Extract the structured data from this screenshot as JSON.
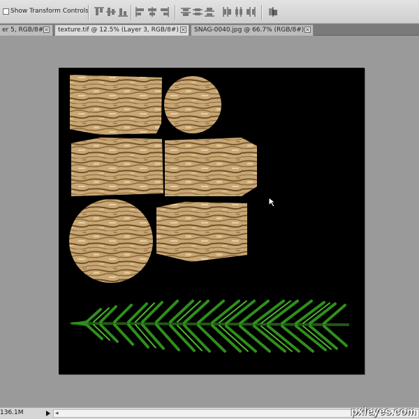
{
  "options_bar": {
    "show_transform_controls": {
      "label": "Show Transform Controls",
      "checked": false
    },
    "align_icons": [
      "align-top-edges-icon",
      "align-vertical-centers-icon",
      "align-bottom-edges-icon",
      "align-left-edges-icon",
      "align-horizontal-centers-icon",
      "align-right-edges-icon"
    ],
    "distribute_icons": [
      "distribute-top-edges-icon",
      "distribute-vertical-centers-icon",
      "distribute-bottom-edges-icon",
      "distribute-left-edges-icon",
      "distribute-horizontal-centers-icon",
      "distribute-right-edges-icon"
    ],
    "auto_align_icon": "auto-align-layers-icon"
  },
  "tabs": [
    {
      "label": "er 5, RGB/8#)",
      "active": false
    },
    {
      "label": "texture.tif @ 12.5% (Layer 3, RGB/8#)",
      "active": true
    },
    {
      "label": "SNAG-0040.jpg @ 66.7% (RGB/8#)",
      "active": false
    }
  ],
  "tab_close_glyph": "×",
  "canvas": {
    "background": "#000000",
    "texture_color": "#c9a774",
    "leaf_color": "#2f8f1c",
    "pieces": [
      "bark-texture-rectangle",
      "bark-texture-circle",
      "bark-texture-rectangle",
      "bark-texture-hexagon",
      "bark-texture-circle",
      "bark-texture-rectangle",
      "palm-leaf"
    ]
  },
  "status_bar": {
    "doc_size": "136.1M",
    "scroll_left_glyph": "◂"
  },
  "watermark": "pxleyes.com"
}
